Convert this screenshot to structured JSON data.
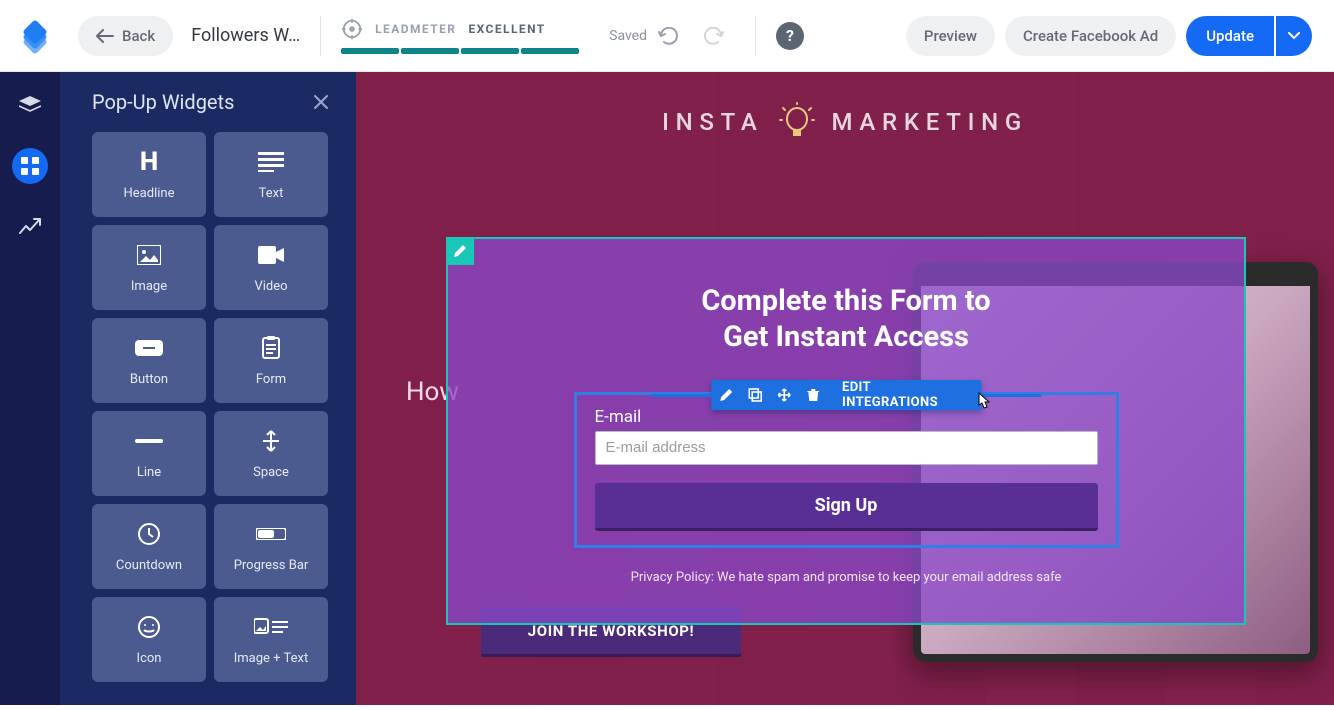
{
  "topbar": {
    "back_label": "Back",
    "page_name": "Followers W…",
    "leadmeter_label": "LEADMETER",
    "leadmeter_rating": "EXCELLENT",
    "leadmeter_segments": 4,
    "saved_text": "Saved",
    "preview_label": "Preview",
    "create_fb_label": "Create Facebook Ad",
    "update_label": "Update"
  },
  "leftpanel": {
    "title": "Pop-Up Widgets",
    "widgets": [
      {
        "label": "Headline",
        "icon": "headline"
      },
      {
        "label": "Text",
        "icon": "text"
      },
      {
        "label": "Image",
        "icon": "image"
      },
      {
        "label": "Video",
        "icon": "video"
      },
      {
        "label": "Button",
        "icon": "button"
      },
      {
        "label": "Form",
        "icon": "form"
      },
      {
        "label": "Line",
        "icon": "line"
      },
      {
        "label": "Space",
        "icon": "space"
      },
      {
        "label": "Countdown",
        "icon": "countdown"
      },
      {
        "label": "Progress Bar",
        "icon": "progress"
      },
      {
        "label": "Icon",
        "icon": "icon"
      },
      {
        "label": "Image + Text",
        "icon": "imgtext"
      }
    ]
  },
  "canvas": {
    "brand_left": "INSTA",
    "brand_right": "MARKETING",
    "how_text": "How",
    "join_text": "JOIN THE WORKSHOP!"
  },
  "popup": {
    "heading_line1": "Complete this Form to",
    "heading_line2": "Get Instant Access",
    "form_label": "E-mail",
    "placeholder": "E-mail address",
    "button_label": "Sign Up",
    "privacy_text": "Privacy Policy: We hate spam and promise to keep your email address safe",
    "toolbar": {
      "edit_integrations": "EDIT INTEGRATIONS"
    }
  }
}
